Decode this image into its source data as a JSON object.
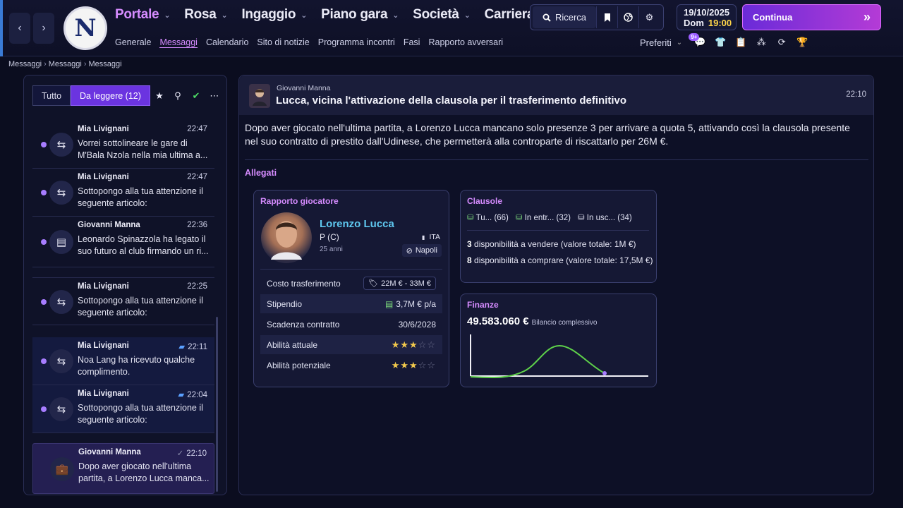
{
  "topbar": {
    "menu": [
      {
        "label": "Portale",
        "active": true
      },
      {
        "label": "Rosa",
        "active": false
      },
      {
        "label": "Ingaggio",
        "active": false
      },
      {
        "label": "Piano gara",
        "active": false
      },
      {
        "label": "Società",
        "active": false
      },
      {
        "label": "Carriera",
        "active": false
      }
    ],
    "submenu": [
      {
        "label": "Generale",
        "active": false
      },
      {
        "label": "Messaggi",
        "active": true
      },
      {
        "label": "Calendario",
        "active": false
      },
      {
        "label": "Sito di notizie",
        "active": false
      },
      {
        "label": "Programma incontri",
        "active": false
      },
      {
        "label": "Fasi",
        "active": false
      },
      {
        "label": "Rapporto avversari",
        "active": false
      }
    ],
    "search_label": "Ricerca",
    "date": "19/10/2025",
    "day": "Dom",
    "clock": "19:00",
    "continue_label": "Continua",
    "favorites_label": "Preferiti",
    "notif_badge": "9+",
    "logo_letter": "N"
  },
  "breadcrumb": [
    "Messaggi",
    "Messaggi",
    "Messaggi"
  ],
  "inbox": {
    "filter_all": "Tutto",
    "filter_unread": "Da leggere (12)",
    "messages": [
      {
        "from": "Mia Livignani",
        "time": "22:47",
        "text": "Vorrei sottolineare le gare di M'Bala Nzola nella mia ultima a...",
        "icon": "scout-icon"
      },
      {
        "from": "Mia Livignani",
        "time": "22:47",
        "text": "Sottopongo alla tua attenzione il seguente articolo:",
        "icon": "scout-icon"
      },
      {
        "from": "Giovanni Manna",
        "time": "22:36",
        "text": "Leonardo Spinazzola ha legato il suo futuro al club firmando un ri...",
        "icon": "contract-icon"
      },
      {
        "from": "Mia Livignani",
        "time": "22:25",
        "text": "Sottopongo alla tua attenzione il seguente articolo:",
        "icon": "scout-icon"
      },
      {
        "from": "Mia Livignani",
        "time": "22:11",
        "text": "Noa Lang ha ricevuto qualche complimento.",
        "icon": "scout-icon"
      },
      {
        "from": "Mia Livignani",
        "time": "22:04",
        "text": "Sottopongo alla tua attenzione il seguente articolo:",
        "icon": "scout-icon"
      },
      {
        "from": "Giovanni Manna",
        "time": "22:10",
        "text": "Dopo aver giocato nell'ultima partita, a Lorenzo Lucca manca...",
        "icon": "briefcase-icon"
      }
    ]
  },
  "message": {
    "sender": "Giovanni Manna",
    "subject": "Lucca, vicina l'attivazione della clausola per il trasferimento definitivo",
    "time": "22:10",
    "body": "Dopo aver giocato nell'ultima partita, a Lorenzo Lucca mancano solo presenze 3 per arrivare a quota 5, attivando così la clausola presente nel suo contratto di prestito dall'Udinese, che permetterà alla controparte di riscattarlo per 26M €.",
    "attachments_label": "Allegati"
  },
  "player_report": {
    "title": "Rapporto giocatore",
    "name": "Lorenzo Lucca",
    "position": "P (C)",
    "age": "25 anni",
    "nationality": "ITA",
    "club": "Napoli",
    "rows": [
      {
        "label": "Costo trasferimento",
        "value": "22M € - 33M €"
      },
      {
        "label": "Stipendio",
        "value": "3,7M € p/a"
      },
      {
        "label": "Scadenza contratto",
        "value": "30/6/2028"
      },
      {
        "label": "Abilità attuale",
        "stars": 3
      },
      {
        "label": "Abilità potenziale",
        "stars": 3
      }
    ],
    "max_stars": 5
  },
  "clauses": {
    "title": "Clausole",
    "tabs": [
      {
        "label": "Tu...",
        "count": "(66)"
      },
      {
        "label": "In entr...",
        "count": "(32)"
      },
      {
        "label": "In usc...",
        "count": "(34)"
      }
    ],
    "line1_num": "3",
    "line1_text": "disponibilità a vendere (valore totale: 1M €)",
    "line2_num": "8",
    "line2_text": "disponibilità a comprare (valore totale: 17,5M €)"
  },
  "finances": {
    "title": "Finanze",
    "amount": "49.583.060 €",
    "caption": "Bilancio complessivo"
  }
}
